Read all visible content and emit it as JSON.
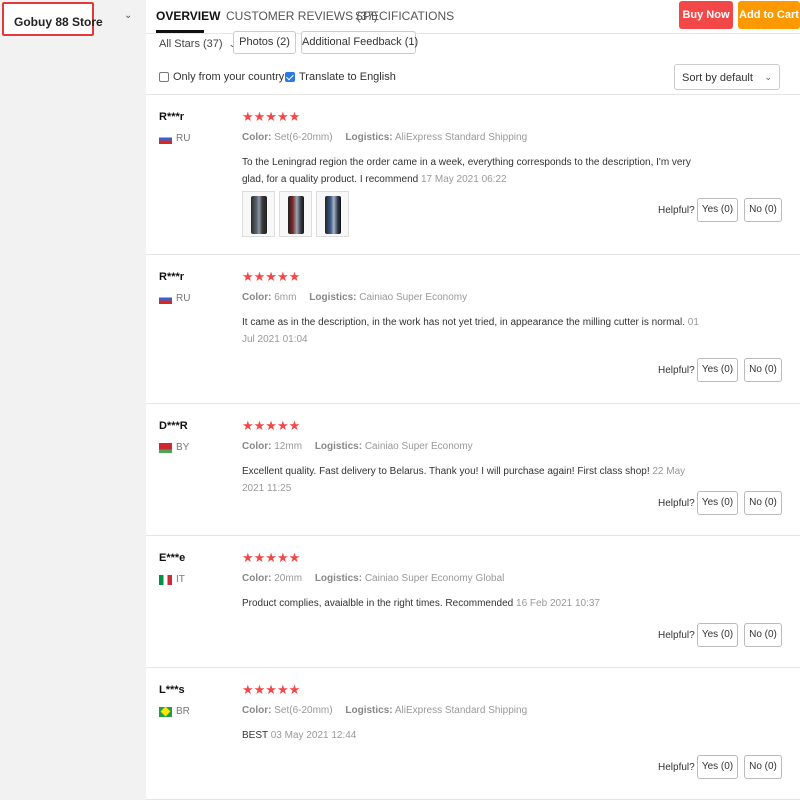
{
  "store": {
    "name": "Gobuy 88 Store",
    "chevron_icon": "chevron-down-icon"
  },
  "nav": {
    "tabs": [
      {
        "label": "OVERVIEW",
        "active": true
      },
      {
        "label": "CUSTOMER REVIEWS (37)",
        "active": false
      },
      {
        "label": "SPECIFICATIONS",
        "active": false
      }
    ],
    "buy_now": "Buy Now",
    "add_to_cart": "Add to Cart"
  },
  "filters": {
    "all_stars": "All Stars (37)",
    "photos": "Photos (2)",
    "additional_feedback": "Additional Feedback (1)",
    "only_your_country": {
      "label": "Only from your country",
      "checked": false
    },
    "translate": {
      "label": "Translate to English",
      "checked": true
    },
    "sort": "Sort by default"
  },
  "colors": {
    "accent_red": "#f44747",
    "accent_orange": "#ff9900",
    "highlight_box": "#e4393c"
  },
  "reviews": [
    {
      "user": "R***r",
      "country": "RU",
      "stars": "★★★★★",
      "color_label": "Color:",
      "color_value": "Set(6-20mm)",
      "logistics_label": "Logistics:",
      "logistics_value": "AliExpress Standard Shipping",
      "text": "To the Leningrad region the order came in a week, everything corresponds to the description, I'm very glad, for a quality product. I recommend",
      "date": "17 May 2021 06:22",
      "helpful": "Helpful?",
      "yes": "Yes (0)",
      "no": "No (0)"
    },
    {
      "user": "R***r",
      "country": "RU",
      "stars": "★★★★★",
      "color_label": "Color:",
      "color_value": "6mm",
      "logistics_label": "Logistics:",
      "logistics_value": "Cainiao Super Economy",
      "text": "It came as in the description, in the work has not yet tried, in appearance the milling cutter is normal.",
      "date": "01 Jul 2021 01:04",
      "helpful": "Helpful?",
      "yes": "Yes (0)",
      "no": "No (0)"
    },
    {
      "user": "D***R",
      "country": "BY",
      "stars": "★★★★★",
      "color_label": "Color:",
      "color_value": "12mm",
      "logistics_label": "Logistics:",
      "logistics_value": "Cainiao Super Economy",
      "text": "Excellent quality. Fast delivery to Belarus. Thank you! I will purchase again! First class shop!",
      "date": "22 May 2021 11:25",
      "helpful": "Helpful?",
      "yes": "Yes (0)",
      "no": "No (0)"
    },
    {
      "user": "E***e",
      "country": "IT",
      "stars": "★★★★★",
      "color_label": "Color:",
      "color_value": "20mm",
      "logistics_label": "Logistics:",
      "logistics_value": "Cainiao Super Economy Global",
      "text": "Product complies, avaialble in the right times. Recommended",
      "date": "16 Feb 2021 10:37",
      "helpful": "Helpful?",
      "yes": "Yes (0)",
      "no": "No (0)"
    },
    {
      "user": "L***s",
      "country": "BR",
      "stars": "★★★★★",
      "color_label": "Color:",
      "color_value": "Set(6-20mm)",
      "logistics_label": "Logistics:",
      "logistics_value": "AliExpress Standard Shipping",
      "text": "BEST",
      "date": "03 May 2021 12:44",
      "helpful": "Helpful?",
      "yes": "Yes (0)",
      "no": "No (0)"
    }
  ]
}
